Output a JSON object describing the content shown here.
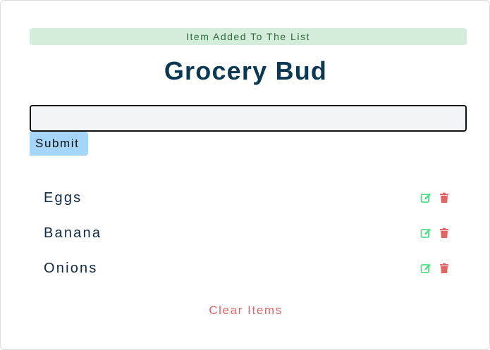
{
  "alert": {
    "text": "Item Added To The List",
    "color": "#d4edda"
  },
  "app": {
    "title": "Grocery Bud"
  },
  "form": {
    "input_value": "",
    "submit_label": "Submit"
  },
  "items": [
    {
      "name": "Eggs",
      "edit_icon": "edit-icon",
      "delete_icon": "trash-icon"
    },
    {
      "name": "Banana",
      "edit_icon": "edit-icon",
      "delete_icon": "trash-icon"
    },
    {
      "name": "Onions",
      "edit_icon": "edit-icon",
      "delete_icon": "trash-icon"
    }
  ],
  "clear_label": "Clear Items",
  "colors": {
    "title": "#0b3954",
    "submit_bg": "#a6d5fa",
    "edit": "#4ade80",
    "delete": "#e06666",
    "clear": "#e06666"
  }
}
